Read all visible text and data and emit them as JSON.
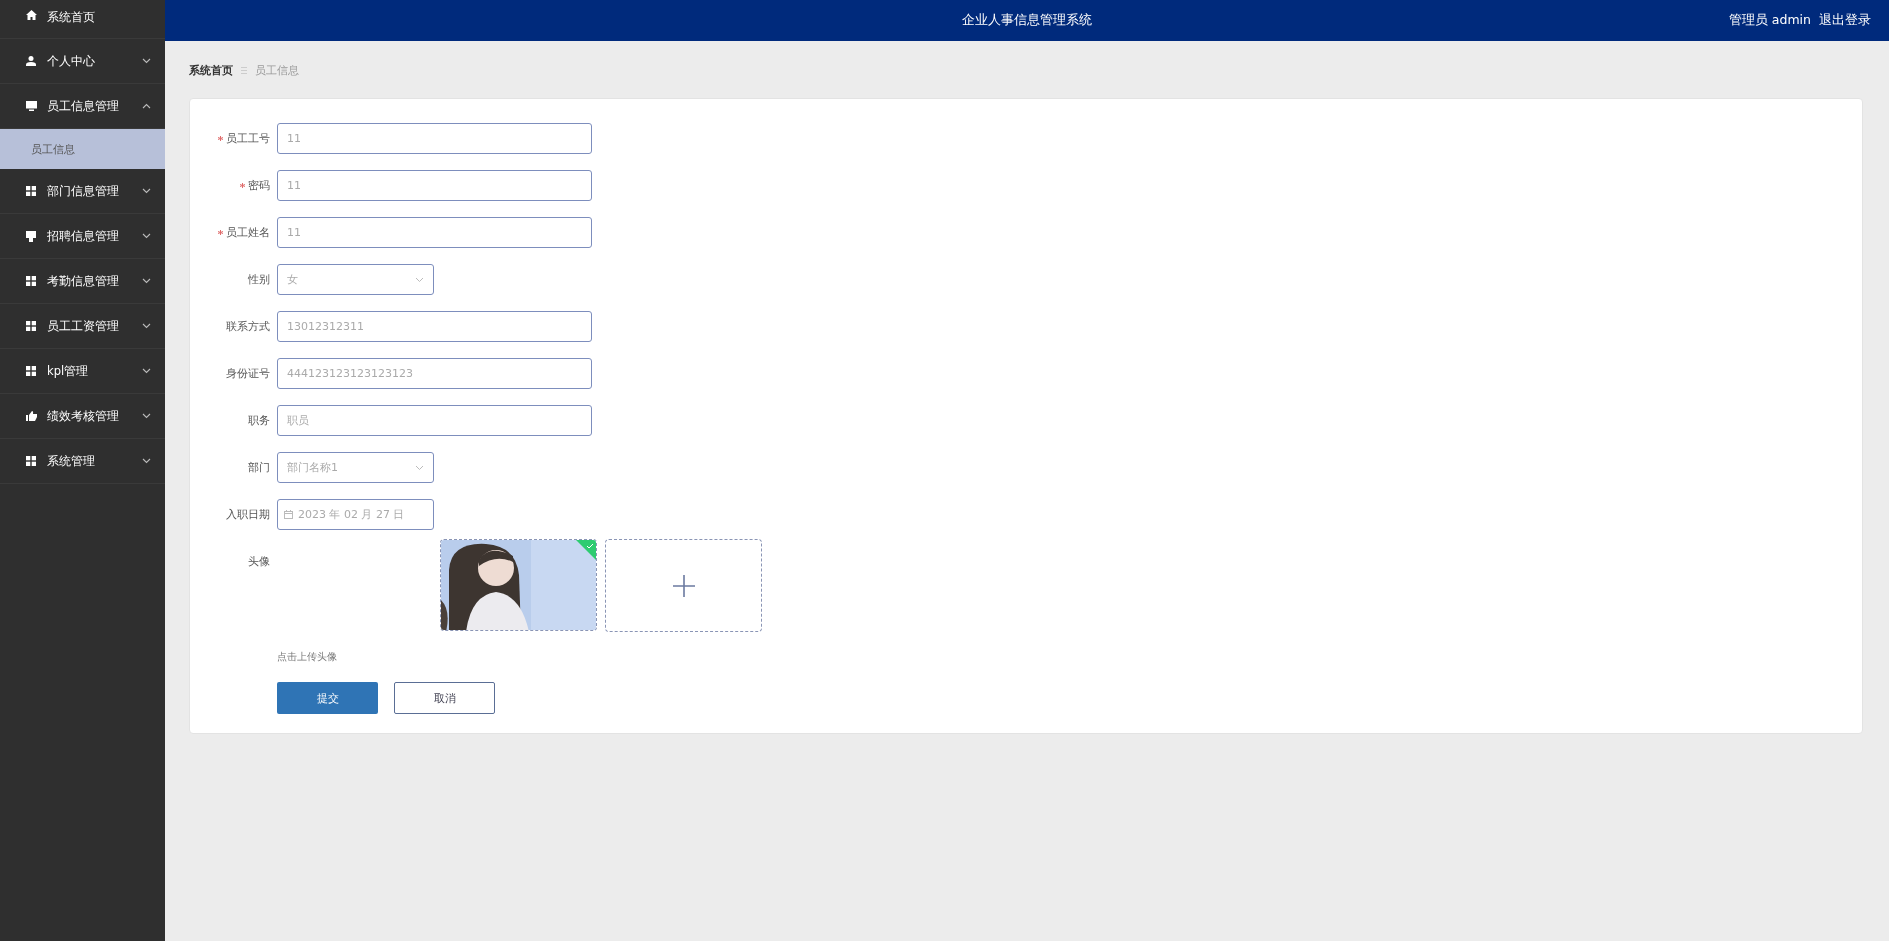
{
  "header": {
    "title": "企业人事信息管理系统",
    "user": "管理员 admin",
    "logout": "退出登录"
  },
  "sidebar": {
    "items": [
      {
        "label": "系统首页",
        "kind": "link",
        "selected": false
      },
      {
        "label": "个人中心",
        "kind": "menu",
        "selected": false,
        "expanded": false
      },
      {
        "label": "员工信息管理",
        "kind": "menu",
        "selected": false,
        "expanded": true,
        "children": [
          {
            "label": "员工信息",
            "selected": true
          }
        ]
      },
      {
        "label": "部门信息管理",
        "kind": "menu",
        "selected": false,
        "expanded": false
      },
      {
        "label": "招聘信息管理",
        "kind": "menu",
        "selected": false,
        "expanded": false
      },
      {
        "label": "考勤信息管理",
        "kind": "menu",
        "selected": false,
        "expanded": false
      },
      {
        "label": "员工工资管理",
        "kind": "menu",
        "selected": false,
        "expanded": false
      },
      {
        "label": "kpl管理",
        "kind": "menu",
        "selected": false,
        "expanded": false
      },
      {
        "label": "绩效考核管理",
        "kind": "menu",
        "selected": false,
        "expanded": false
      },
      {
        "label": "系统管理",
        "kind": "menu",
        "selected": false,
        "expanded": false
      }
    ]
  },
  "breadcrumb": [
    {
      "label": "系统首页"
    },
    {
      "label": "员工信息"
    }
  ],
  "form": {
    "fields": [
      {
        "label": "员工工号",
        "kind": "input",
        "required": true,
        "value": "11"
      },
      {
        "label": "密码",
        "kind": "input",
        "required": true,
        "value": "11"
      },
      {
        "label": "员工姓名",
        "kind": "input",
        "required": true,
        "value": "11"
      },
      {
        "label": "性别",
        "kind": "select",
        "required": false,
        "value": "女"
      },
      {
        "label": "联系方式",
        "kind": "input",
        "required": false,
        "value": "13012312311"
      },
      {
        "label": "身份证号",
        "kind": "input",
        "required": false,
        "value": "444123123123123123"
      },
      {
        "label": "职务",
        "kind": "input",
        "required": false,
        "value": "职员"
      },
      {
        "label": "部门",
        "kind": "select",
        "required": false,
        "value": "部门名称1"
      },
      {
        "label": "入职日期",
        "kind": "date",
        "required": false,
        "value": "2023 年 02 月 27 日"
      },
      {
        "label": "头像",
        "kind": "upload",
        "required": false,
        "hint": "点击上传头像",
        "uploaded": true
      }
    ],
    "buttons": [
      {
        "label": "提交",
        "kind": "primary"
      },
      {
        "label": "取消",
        "kind": "plain"
      }
    ]
  }
}
